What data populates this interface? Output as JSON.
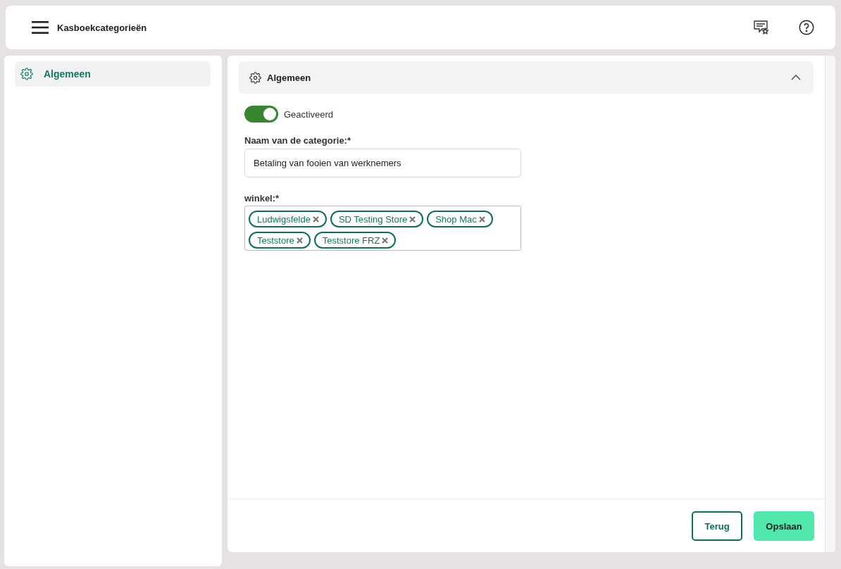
{
  "header": {
    "title": "Kasboekcategorieën"
  },
  "sidebar": {
    "items": [
      {
        "label": "Algemeen",
        "selected": true
      }
    ]
  },
  "section": {
    "title": "Algemeen",
    "expanded": true
  },
  "toggle": {
    "label": "Geactiveerd",
    "on": true
  },
  "name_field": {
    "label": "Naam van de categorie:*",
    "value": "Betaling van fooien van werknemers"
  },
  "store_field": {
    "label": "winkel:*",
    "tags": [
      {
        "label": "Ludwigsfelde"
      },
      {
        "label": "SD Testing Store"
      },
      {
        "label": "Shop Mac"
      },
      {
        "label": "Teststore"
      },
      {
        "label": "Teststore FRZ"
      }
    ]
  },
  "buttons": [
    {
      "label": "Terug",
      "kind": "secondary"
    },
    {
      "label": "Opslaan",
      "kind": "primary"
    }
  ]
}
